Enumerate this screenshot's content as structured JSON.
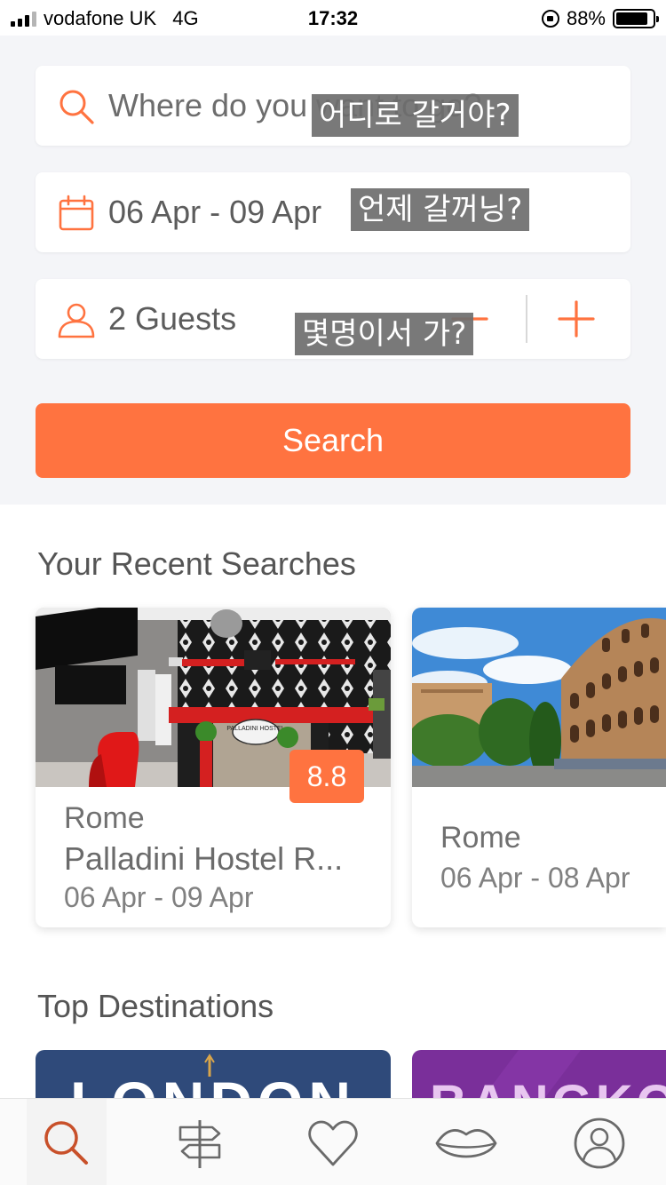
{
  "status_bar": {
    "carrier": "vodafone UK",
    "network": "4G",
    "time": "17:32",
    "battery_percent": "88%",
    "battery_level": 0.88
  },
  "search": {
    "destination_placeholder": "Where do you want to go?",
    "destination_overlay": "어디로 갈거야?",
    "dates_value": "06 Apr - 09 Apr",
    "dates_overlay": "언제 갈꺼닝?",
    "guests_value": "2  Guests",
    "guests_overlay": "몇명이서 가?",
    "search_button_label": "Search"
  },
  "recent_searches": {
    "title": "Your Recent Searches",
    "cards": [
      {
        "city": "Rome",
        "name": "Palladini Hostel R...",
        "dates": "06 Apr - 09 Apr",
        "rating": "8.8",
        "sign": "PALLADINI HOSTEL"
      },
      {
        "city": "Rome",
        "dates": "06 Apr - 08 Apr"
      }
    ]
  },
  "top_destinations": {
    "title": "Top Destinations",
    "items": [
      {
        "name": "LONDON"
      },
      {
        "name": "BANGKOK"
      }
    ]
  },
  "bottom_nav": {
    "items": [
      {
        "icon": "search-icon",
        "active": true
      },
      {
        "icon": "signpost-icon",
        "active": false
      },
      {
        "icon": "heart-icon",
        "active": false
      },
      {
        "icon": "lips-icon",
        "active": false
      },
      {
        "icon": "profile-icon",
        "active": false
      }
    ]
  },
  "colors": {
    "accent": "#ff7340",
    "panel_background": "#f4f5f8",
    "london_tile": "#2f4a7a",
    "bangkok_tile": "#7a2f9a"
  }
}
